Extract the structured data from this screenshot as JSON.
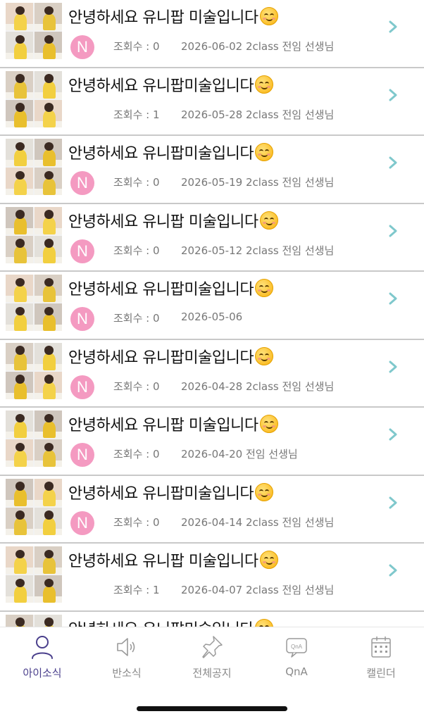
{
  "colors": {
    "avatar_bg": "#f49ac1",
    "chevron": "#7fc8cc",
    "active_tab": "#4a3f8c",
    "inactive_tab": "#9a9a9a"
  },
  "posts": [
    {
      "title": "안녕하세요 유니팝 미술입니다",
      "has_avatar": true,
      "views": "조회수 : 0",
      "info": "2026-06-02 2class 전임 선생님"
    },
    {
      "title": "안녕하세요 유니팝미술입니다",
      "has_avatar": false,
      "views": "조회수 : 1",
      "info": "2026-05-28 2class 전임 선생님"
    },
    {
      "title": "안녕하세요 유니팝미술입니다",
      "has_avatar": true,
      "views": "조회수 : 0",
      "info": "2026-05-19 2class 전임 선생님"
    },
    {
      "title": "안녕하세요 유니팝 미술입니다",
      "has_avatar": true,
      "views": "조회수 : 0",
      "info": "2026-05-12 2class 전임 선생님"
    },
    {
      "title": "안녕하세요 유니팝미술입니다",
      "has_avatar": true,
      "views": "조회수 : 0",
      "info": "2026-05-06"
    },
    {
      "title": "안녕하세요 유니팝미술입니다",
      "has_avatar": true,
      "views": "조회수 : 0",
      "info": "2026-04-28 2class 전임 선생님"
    },
    {
      "title": "안녕하세요 유니팝 미술입니다",
      "has_avatar": true,
      "views": "조회수 : 0",
      "info": "2026-04-20 전임  선생님"
    },
    {
      "title": "안녕하세요 유니팝미술입니다",
      "has_avatar": true,
      "views": "조회수 : 0",
      "info": "2026-04-14 2class 전임 선생님"
    },
    {
      "title": "안녕하세요 유니팝 미술입니다",
      "has_avatar": false,
      "views": "조회수 : 1",
      "info": "2026-04-07 2class 전임 선생님"
    },
    {
      "title": "안녕하세요 유니팝미술입니다",
      "has_avatar": false,
      "views": "",
      "info": ""
    }
  ],
  "avatar_letter": "N",
  "tabs": [
    {
      "label": "아이소식",
      "icon": "person-icon",
      "active": true
    },
    {
      "label": "반소식",
      "icon": "speaker-icon",
      "active": false
    },
    {
      "label": "전체공지",
      "icon": "pushpin-icon",
      "active": false
    },
    {
      "label": "QnA",
      "icon": "qna-bubble-icon",
      "active": false
    },
    {
      "label": "캘린더",
      "icon": "calendar-icon",
      "active": false
    }
  ],
  "qna_icon_text": "QnA"
}
